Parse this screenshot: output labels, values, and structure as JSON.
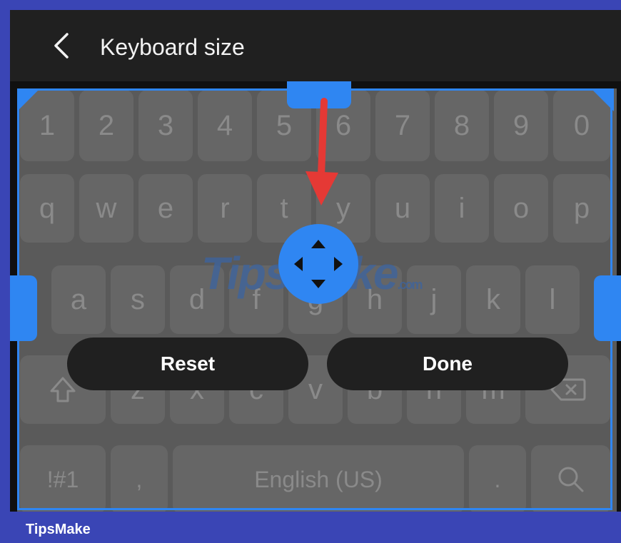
{
  "header": {
    "title": "Keyboard size"
  },
  "keyboard": {
    "row_numbers": [
      "1",
      "2",
      "3",
      "4",
      "5",
      "6",
      "7",
      "8",
      "9",
      "0"
    ],
    "row_top": [
      "q",
      "w",
      "e",
      "r",
      "t",
      "y",
      "u",
      "i",
      "o",
      "p"
    ],
    "row_home": [
      "a",
      "s",
      "d",
      "f",
      "g",
      "h",
      "j",
      "k",
      "l"
    ],
    "row_bottom": [
      "z",
      "x",
      "c",
      "v",
      "b",
      "n",
      "m"
    ],
    "symbols_label": "!#1",
    "comma_label": ",",
    "space_label": "English (US)",
    "period_label": "."
  },
  "actions": {
    "reset_label": "Reset",
    "done_label": "Done"
  },
  "watermark": {
    "text": "TipsMake",
    "suffix": ".com"
  },
  "footer": {
    "brand": "TipsMake"
  },
  "colors": {
    "accent": "#2f86f2",
    "frame": "#3a45b5",
    "arrow": "#e53935"
  }
}
